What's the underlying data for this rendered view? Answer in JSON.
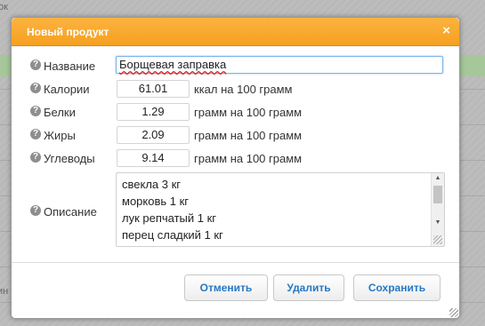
{
  "background": {
    "fragment_top": "ок",
    "fragment_left": "ин"
  },
  "dialog": {
    "title": "Новый продукт",
    "close_glyph": "×"
  },
  "fields": {
    "name": {
      "label": "Название",
      "value": "Борщевая заправка"
    },
    "calories": {
      "label": "Калории",
      "value": "61.01",
      "unit": "ккал на 100 грамм"
    },
    "protein": {
      "label": "Белки",
      "value": "1.29",
      "unit": "грамм на 100 грамм"
    },
    "fat": {
      "label": "Жиры",
      "value": "2.09",
      "unit": "грамм на 100 грамм"
    },
    "carbs": {
      "label": "Углеводы",
      "value": "9.14",
      "unit": "грамм на 100 грамм"
    },
    "description": {
      "label": "Описание",
      "lines": [
        "свекла 3 кг",
        "морковь 1 кг",
        "лук репчатый 1 кг",
        "перец сладкий 1 кг"
      ]
    }
  },
  "help_glyph": "?",
  "buttons": {
    "cancel": "Отменить",
    "delete": "Удалить",
    "save": "Сохранить"
  },
  "colors": {
    "titlebar": "#f6a01f",
    "button_text": "#2778c4"
  }
}
